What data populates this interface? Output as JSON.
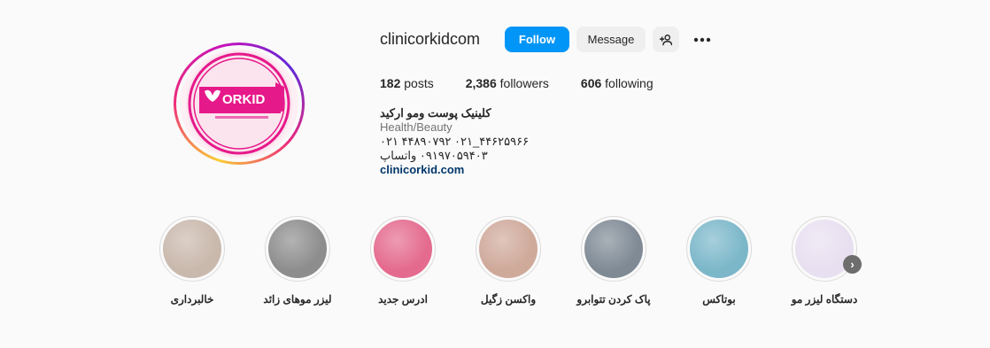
{
  "profile": {
    "username": "clinicorkidcom",
    "follow_label": "Follow",
    "message_label": "Message",
    "suggest_icon": "add-user-icon",
    "more_icon": "more-horizontal-icon",
    "avatar_logo_text": "ORKID"
  },
  "stats": {
    "posts_count": "182",
    "posts_label": "posts",
    "followers_count": "2,386",
    "followers_label": "followers",
    "following_count": "606",
    "following_label": "following"
  },
  "bio": {
    "name": "کلینیک پوست ومو ارکید",
    "category": "Health/Beauty",
    "line1": "۰۲۱ ۴۴۸۹۰۷۹۲ ۰۲۱_۴۴۶۲۵۹۶۶",
    "line2": "۰۹۱۹۷۰۵۹۴۰۳ واتساپ",
    "link": "clinicorkid.com"
  },
  "highlights": [
    {
      "label": "خالبرداری",
      "thumb": "#c9b8ac"
    },
    {
      "label": "لیزر موهای زائد",
      "thumb": "#8d8d8d"
    },
    {
      "label": "ادرس جدید",
      "thumb": "#e46a8e"
    },
    {
      "label": "واکسن زگیل",
      "thumb": "#cfa99a"
    },
    {
      "label": "پاک کردن تتوابرو",
      "thumb": "#7f8a95"
    },
    {
      "label": "بوتاکس",
      "thumb": "#7bb7c9"
    },
    {
      "label": "دستگاه لیزر مو",
      "thumb": "#e8dff0"
    }
  ],
  "highlights_next_icon": "chevron-right-icon",
  "colors": {
    "accent": "#0095f6",
    "link": "#00376b",
    "logo_pink": "#e6198a"
  }
}
